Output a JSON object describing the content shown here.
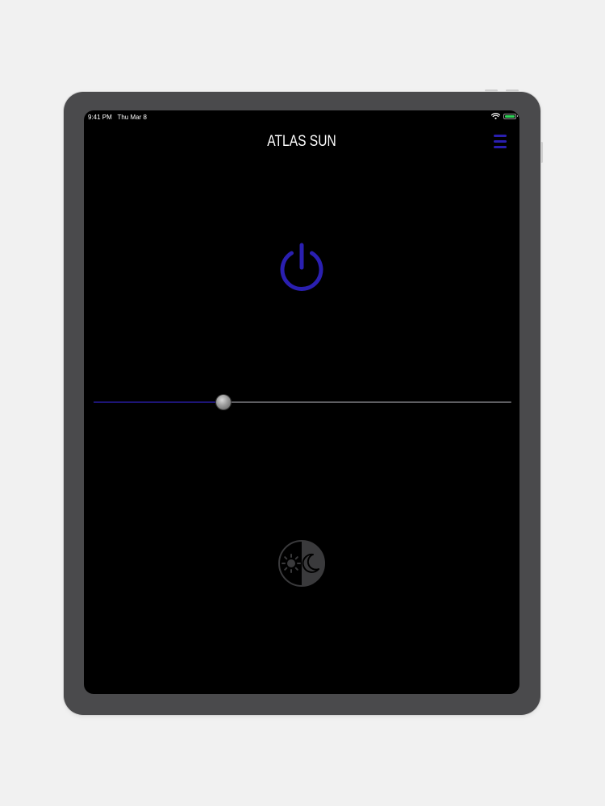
{
  "status_bar": {
    "time": "9:41 PM",
    "date": "Thu Mar 8",
    "wifi_icon": "wifi-icon",
    "battery_icon": "battery-icon",
    "battery_level": 1.0,
    "battery_color": "#30d158"
  },
  "header": {
    "title": "ATLAS SUN",
    "menu_icon": "hamburger-menu-icon",
    "accent_color": "#2a1fb0"
  },
  "controls": {
    "power_icon": "power-icon",
    "brightness_level": 0.31,
    "mode_icon": "day-night-icon"
  }
}
